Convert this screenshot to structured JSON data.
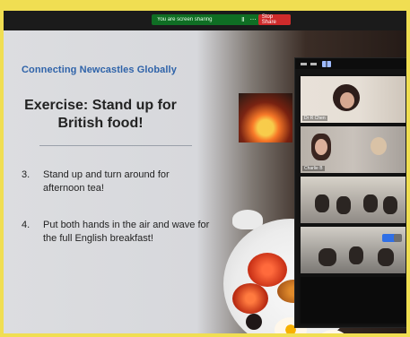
{
  "slide": {
    "brand": "Connecting Newcastles Globally",
    "title": "Exercise: Stand up for British food!",
    "items": [
      {
        "num": "3.",
        "text": "Stand up and turn around for afternoon tea!"
      },
      {
        "num": "4.",
        "text": "Put both hands in the air and wave for the full English breakfast!"
      }
    ]
  },
  "share_bar": {
    "status": "You are screen sharing",
    "stop_label": "Stop Share"
  },
  "participants": [
    {
      "name": "Dr R Chen"
    },
    {
      "name": "Charlie B"
    },
    {
      "name": ""
    },
    {
      "name": ""
    },
    {
      "name": ""
    }
  ],
  "colors": {
    "brand_blue": "#2f63a9",
    "share_green": "#0f6e24",
    "stop_red": "#cf2b2b"
  }
}
